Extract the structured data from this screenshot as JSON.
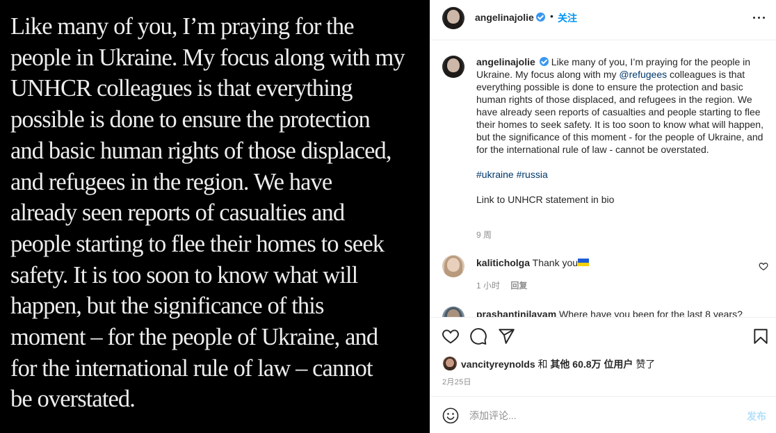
{
  "media": {
    "lines": [
      "Like many of you, I’m praying for the",
      "people in Ukraine. My focus along with my",
      "UNHCR colleagues is that everything",
      "possible is done to ensure the protection",
      "and basic human rights of those displaced,",
      "and refugees in the region. We have",
      "already seen reports of casualties and",
      "people starting to flee their homes to seek",
      "safety. It is too soon to know what will",
      "happen, but the significance of this",
      "moment – for the people of Ukraine, and",
      "for the international rule of law – cannot",
      "be overstated."
    ]
  },
  "header": {
    "username": "angelinajolie",
    "separator": "•",
    "follow_label": "关注"
  },
  "caption": {
    "username": "angelinajolie",
    "text_before_mention": "Like many of you, I’m praying for the people in Ukraine. My focus along with my",
    "mention": "@refugees",
    "text_after_mention": "colleagues is that everything possible is done to ensure the protection and basic human rights of those displaced, and refugees in the region. We have already seen reports of casualties and people starting to flee their homes to seek safety. It is too soon to know what will happen, but the significance of this moment - for the people of Ukraine, and for the international rule of law - cannot be overstated.",
    "hashtag_1": "#ukraine",
    "hashtag_2": "#russia",
    "link_note": "Link to UNHCR statement in bio",
    "time_ago": "9 周"
  },
  "comments": [
    {
      "username": "kaliticholga",
      "text": "Thank you",
      "time_ago": "1 小时",
      "reply_label": "回复"
    },
    {
      "username": "prashantinilayam",
      "text": "Where have you been for the last 8 years?"
    }
  ],
  "likes": {
    "username": "vancityreynolds",
    "conjunction": "和",
    "others": "其他 60.8万 位用户",
    "suffix": "赞了"
  },
  "post_date": "2月25日",
  "comment_box": {
    "placeholder": "添加评论...",
    "post_label": "发布"
  }
}
